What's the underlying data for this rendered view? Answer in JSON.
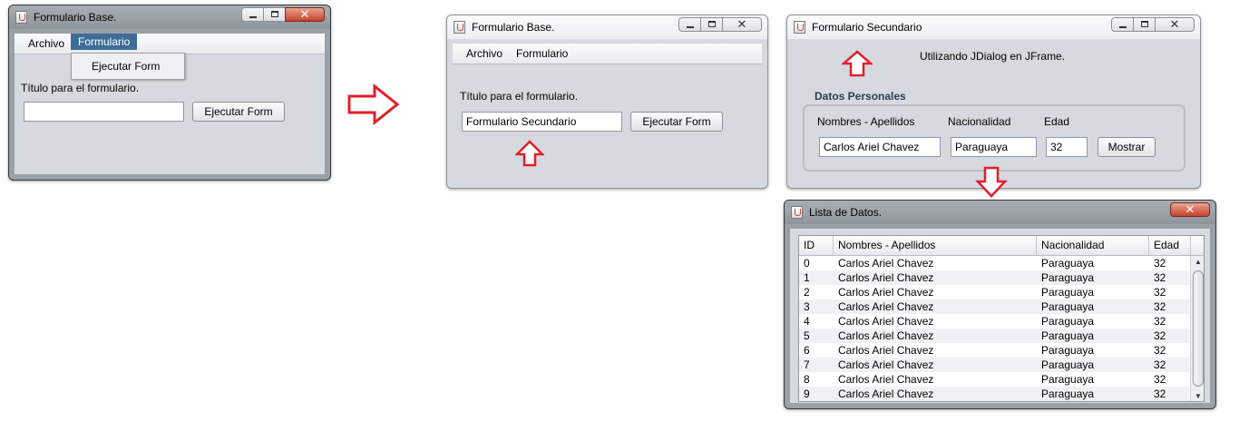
{
  "windows": {
    "base_open": {
      "title": "Formulario Base.",
      "menu": [
        "Archivo",
        "Formulario"
      ],
      "popup_item": "Ejecutar Form",
      "label": "Título para el formulario.",
      "input_value": "",
      "button": "Ejecutar Form"
    },
    "base_filled": {
      "title": "Formulario Base.",
      "menu": [
        "Archivo",
        "Formulario"
      ],
      "label": "Título para el formulario.",
      "input_value": "Formulario Secundario",
      "button": "Ejecutar Form"
    },
    "secondary": {
      "title": "Formulario Secundario",
      "heading": "Utilizando JDialog en JFrame.",
      "group_title": "Datos Personales",
      "labels": [
        "Nombres - Apellidos",
        "Nacionalidad",
        "Edad"
      ],
      "values": [
        "Carlos Ariel Chavez",
        "Paraguaya",
        "32"
      ],
      "button": "Mostrar"
    },
    "list": {
      "title": "Lista de Datos.",
      "columns": [
        "ID",
        "Nombres - Apellidos",
        "Nacionalidad",
        "Edad"
      ],
      "rows": [
        [
          "0",
          "Carlos Ariel Chavez",
          "Paraguaya",
          "32"
        ],
        [
          "1",
          "Carlos Ariel Chavez",
          "Paraguaya",
          "32"
        ],
        [
          "2",
          "Carlos Ariel Chavez",
          "Paraguaya",
          "32"
        ],
        [
          "3",
          "Carlos Ariel Chavez",
          "Paraguaya",
          "32"
        ],
        [
          "4",
          "Carlos Ariel Chavez",
          "Paraguaya",
          "32"
        ],
        [
          "5",
          "Carlos Ariel Chavez",
          "Paraguaya",
          "32"
        ],
        [
          "6",
          "Carlos Ariel Chavez",
          "Paraguaya",
          "32"
        ],
        [
          "7",
          "Carlos Ariel Chavez",
          "Paraguaya",
          "32"
        ],
        [
          "8",
          "Carlos Ariel Chavez",
          "Paraguaya",
          "32"
        ],
        [
          "9",
          "Carlos Ariel Chavez",
          "Paraguaya",
          "32"
        ]
      ]
    }
  },
  "colors": {
    "arrow": "#e0202a",
    "menu_active": "#3d6d96"
  },
  "icons": [
    "java-app-icon",
    "minimize-icon",
    "maximize-icon",
    "close-icon",
    "right-arrow-icon",
    "up-arrow-icon",
    "down-arrow-icon",
    "scroll-up-icon",
    "scroll-down-icon"
  ]
}
